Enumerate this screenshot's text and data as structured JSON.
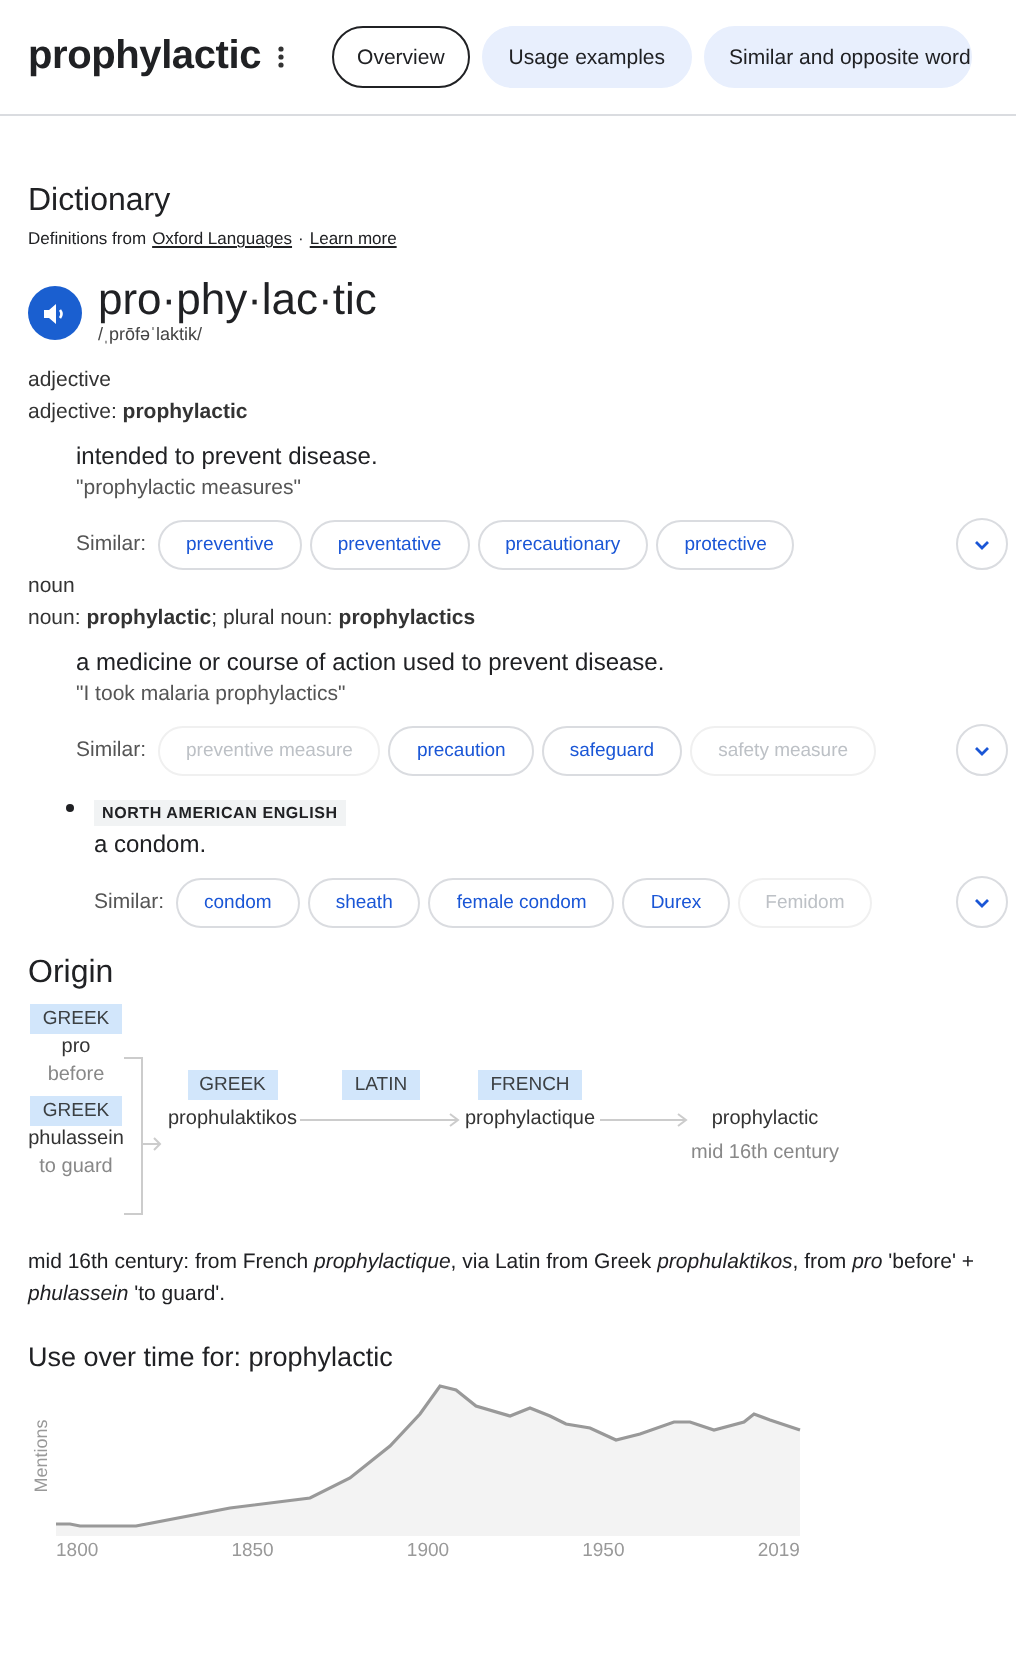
{
  "header": {
    "title": "prophylactic",
    "tabs": [
      {
        "label": "Overview",
        "selected": true
      },
      {
        "label": "Usage examples",
        "selected": false
      },
      {
        "label": "Similar and opposite word",
        "selected": false
      }
    ]
  },
  "dictionary": {
    "heading": "Dictionary",
    "source": {
      "prefix": "Definitions from",
      "link": "Oxford Languages",
      "separator": "·",
      "learn_more": "Learn more"
    },
    "headword": "pro·phy·lac·tic",
    "phonetic": "/ˌprōfəˈlaktik/",
    "groups": [
      {
        "pos": "adjective",
        "forms": "adjective: **prophylactic**",
        "definitions": [
          {
            "kind": "plain",
            "text": "intended to prevent disease.",
            "example": "\"prophylactic measures\"",
            "similar_label": "Similar:",
            "similar": [
              {
                "label": "preventive",
                "disabled": false
              },
              {
                "label": "preventative",
                "disabled": false
              },
              {
                "label": "precautionary",
                "disabled": false
              },
              {
                "label": "protective",
                "disabled": false
              }
            ]
          }
        ]
      },
      {
        "pos": "noun",
        "forms": "noun: **prophylactic**; plural noun: **prophylactics**",
        "definitions": [
          {
            "kind": "plain",
            "text": "a medicine or course of action used to prevent disease.",
            "example": "\"I took malaria prophylactics\"",
            "similar_label": "Similar:",
            "similar": [
              {
                "label": "preventive measure",
                "disabled": true
              },
              {
                "label": "precaution",
                "disabled": false
              },
              {
                "label": "safeguard",
                "disabled": false
              },
              {
                "label": "safety measure",
                "disabled": true
              }
            ]
          },
          {
            "kind": "bulleted",
            "region": "NORTH AMERICAN ENGLISH",
            "text": "a condom.",
            "similar_label": "Similar:",
            "similar": [
              {
                "label": "condom",
                "disabled": false
              },
              {
                "label": "sheath",
                "disabled": false
              },
              {
                "label": "female condom",
                "disabled": false
              },
              {
                "label": "Durex",
                "disabled": false
              },
              {
                "label": "Femidom",
                "disabled": true
              }
            ]
          }
        ]
      }
    ]
  },
  "origin": {
    "heading": "Origin",
    "roots": [
      {
        "language": "GREEK",
        "word": "pro",
        "gloss": "before"
      },
      {
        "language": "GREEK",
        "word": "phulassein",
        "gloss": "to guard"
      }
    ],
    "stages": [
      {
        "language": "GREEK",
        "word": "prophulaktikos"
      },
      {
        "language": "LATIN"
      },
      {
        "language": "FRENCH",
        "word": "prophylactique"
      },
      {
        "word": "prophylactic",
        "date": "mid 16th century"
      }
    ],
    "note": "mid 16th century: from French *prophylactique*, via Latin from Greek *prophulaktikos*, from *pro* 'before' + *phulassein* 'to guard'."
  },
  "usage": {
    "title": "Use over time for: prophylactic",
    "ylabel": "Mentions",
    "x_labels": [
      "1800",
      "1850",
      "1900",
      "1950",
      "2019"
    ]
  }
}
